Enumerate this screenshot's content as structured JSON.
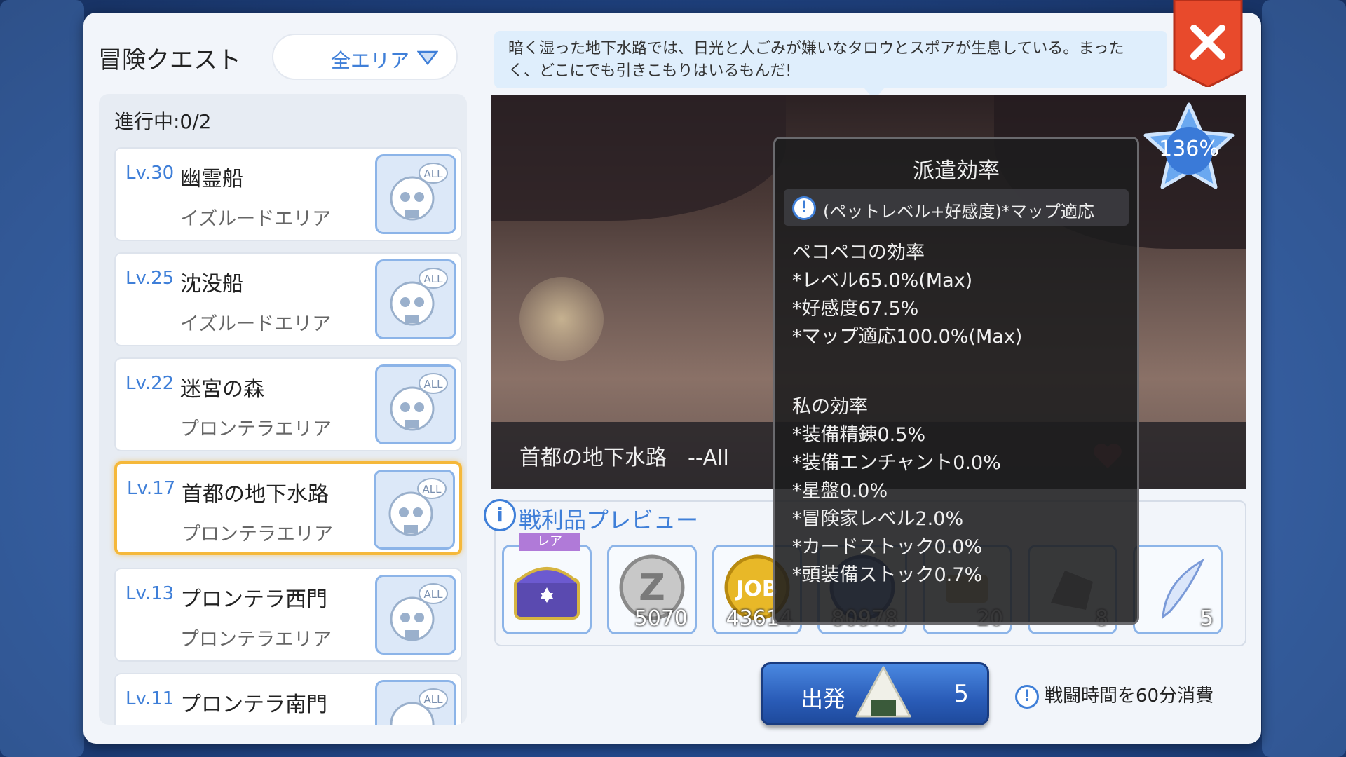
{
  "window": {
    "title": "冒険クエスト",
    "area_filter": "全エリア"
  },
  "quest_list": {
    "progress": "進行中:0/2",
    "items": [
      {
        "level": "Lv.30",
        "name": "幽霊船",
        "area": "イズルードエリア",
        "badge": "ALL"
      },
      {
        "level": "Lv.25",
        "name": "沈没船",
        "area": "イズルードエリア",
        "badge": "ALL"
      },
      {
        "level": "Lv.22",
        "name": "迷宮の森",
        "area": "プロンテラエリア",
        "badge": "ALL"
      },
      {
        "level": "Lv.17",
        "name": "首都の地下水路",
        "area": "プロンテラエリア",
        "badge": "ALL"
      },
      {
        "level": "Lv.13",
        "name": "プロンテラ西門",
        "area": "プロンテラエリア",
        "badge": "ALL"
      },
      {
        "level": "Lv.11",
        "name": "プロンテラ南門",
        "area": "",
        "badge": "ALL"
      }
    ],
    "selected_index": 3
  },
  "description": "暗く湿った地下水路では、日光と人ごみが嫌いなタロウとスポアが生息している。まったく、どこにでも引きこもりはいるもんだ!",
  "scene": {
    "map_name": "首都の地下水路　--All",
    "efficiency_badge": "136%"
  },
  "tooltip": {
    "title": "派遣効率",
    "formula": "(ペットレベル+好感度)*マップ適応",
    "pet_section": {
      "heading": "ペコペコの効率",
      "lines": [
        "*レベル65.0%(Max)",
        "*好感度67.5%",
        "*マップ適応100.0%(Max)"
      ]
    },
    "my_section": {
      "heading": "私の効率",
      "lines": [
        "*装備精錬0.5%",
        "*装備エンチャント0.0%",
        "*星盤0.0%",
        "*冒険家レベル2.0%",
        "*カードストック0.0%",
        "*頭装備ストック0.7%"
      ]
    }
  },
  "preview": {
    "title": "戦利品プレビュー",
    "rare_tag": "レア",
    "rewards": [
      {
        "icon": "treasure-chest-icon",
        "count": ""
      },
      {
        "icon": "zeny-coin-icon",
        "count": "5070"
      },
      {
        "icon": "job-exp-icon",
        "count": "43614"
      },
      {
        "icon": "base-exp-icon",
        "count": "80978"
      },
      {
        "icon": "item-icon",
        "count": "20"
      },
      {
        "icon": "stone-icon",
        "count": "8"
      },
      {
        "icon": "feather-icon",
        "count": "5"
      }
    ]
  },
  "depart": {
    "label": "出発",
    "count": "5"
  },
  "notice": "戦闘時間を60分消費",
  "colors": {
    "accent_blue": "#3f7fd8",
    "selected_border": "#f5b83a",
    "close_red": "#e84a2c"
  }
}
